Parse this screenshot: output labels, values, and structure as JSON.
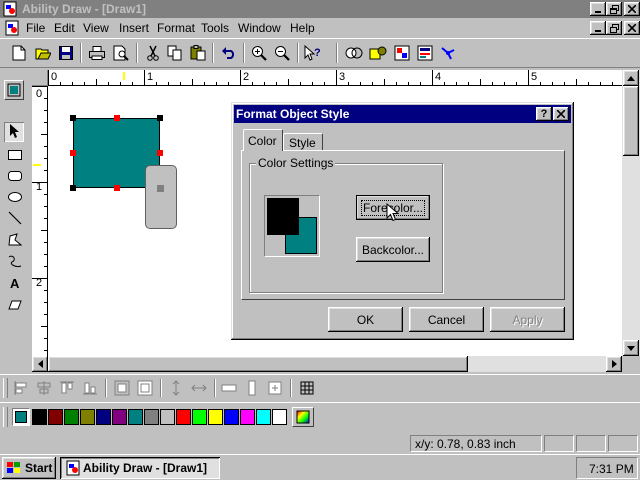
{
  "app": {
    "title": "Ability Draw - [Draw1]"
  },
  "menu": {
    "items": [
      "File",
      "Edit",
      "View",
      "Insert",
      "Format",
      "Tools",
      "Window",
      "Help"
    ]
  },
  "ruler": {
    "h_labels": [
      "0",
      "1",
      "2",
      "3",
      "4",
      "5"
    ],
    "v_labels": [
      "0",
      "1",
      "2"
    ]
  },
  "dialog": {
    "title": "Format Object Style",
    "help_label": "?",
    "close_label": "✕",
    "tabs": [
      "Color",
      "Style"
    ],
    "active_tab": "Color",
    "group_label": "Color Settings",
    "forecolor_label": "Forecolor...",
    "backcolor_label": "Backcolor...",
    "ok_label": "OK",
    "cancel_label": "Cancel",
    "apply_label": "Apply",
    "forecolor": "#000000",
    "backcolor": "#008080"
  },
  "palette": {
    "current": "#008080",
    "colors": [
      "#000000",
      "#800000",
      "#008000",
      "#808000",
      "#000080",
      "#800080",
      "#008080",
      "#808080",
      "#c0c0c0",
      "#ff0000",
      "#00ff00",
      "#ffff00",
      "#0000ff",
      "#ff00ff",
      "#00ffff",
      "#ffffff"
    ]
  },
  "statusbar": {
    "coords": "x/y: 0.78, 0.83 inch"
  },
  "taskbar": {
    "start_label": "Start",
    "task_label": "Ability Draw - [Draw1]",
    "clock": "7:31 PM"
  },
  "colors": {
    "title_active": "#000080",
    "title_inactive": "#808080",
    "shape_fill": "#008080"
  }
}
